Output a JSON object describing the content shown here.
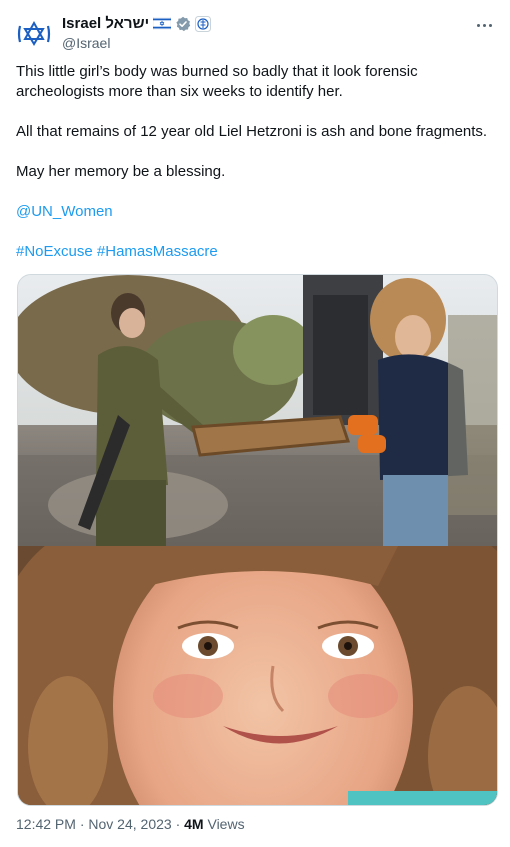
{
  "author": {
    "display_name": "Israel ישראל",
    "handle": "@Israel",
    "avatar_icon": "star-of-david-icon",
    "flag_icon": "israel-flag-icon",
    "verified_icon": "gray-verified-badge-icon",
    "affiliate_icon": "government-emblem-icon"
  },
  "post": {
    "paragraph_1": "This little girl’s body was burned so badly that it look forensic archeologists more than six weeks to identify her.",
    "paragraph_2": "All that remains of 12 year old Liel Hetzroni is ash and bone fragments.",
    "paragraph_3": "May her memory be a blessing.",
    "mention": "@UN_Women",
    "hashtag_1": "#NoExcuse",
    "hashtag_2": "#HamasMassacre"
  },
  "media": {
    "top_image_icon": "photo-soldier-sifting-ash",
    "bottom_image_icon": "photo-smiling-girl-portrait"
  },
  "meta": {
    "time": "12:42 PM",
    "separator": "·",
    "date": "Nov 24, 2023",
    "views_count": "4M",
    "views_label": "Views"
  },
  "colors": {
    "link": "#1d9bf0",
    "secondary_text": "#536471",
    "primary_text": "#0f1419",
    "border": "#cfd9de"
  }
}
